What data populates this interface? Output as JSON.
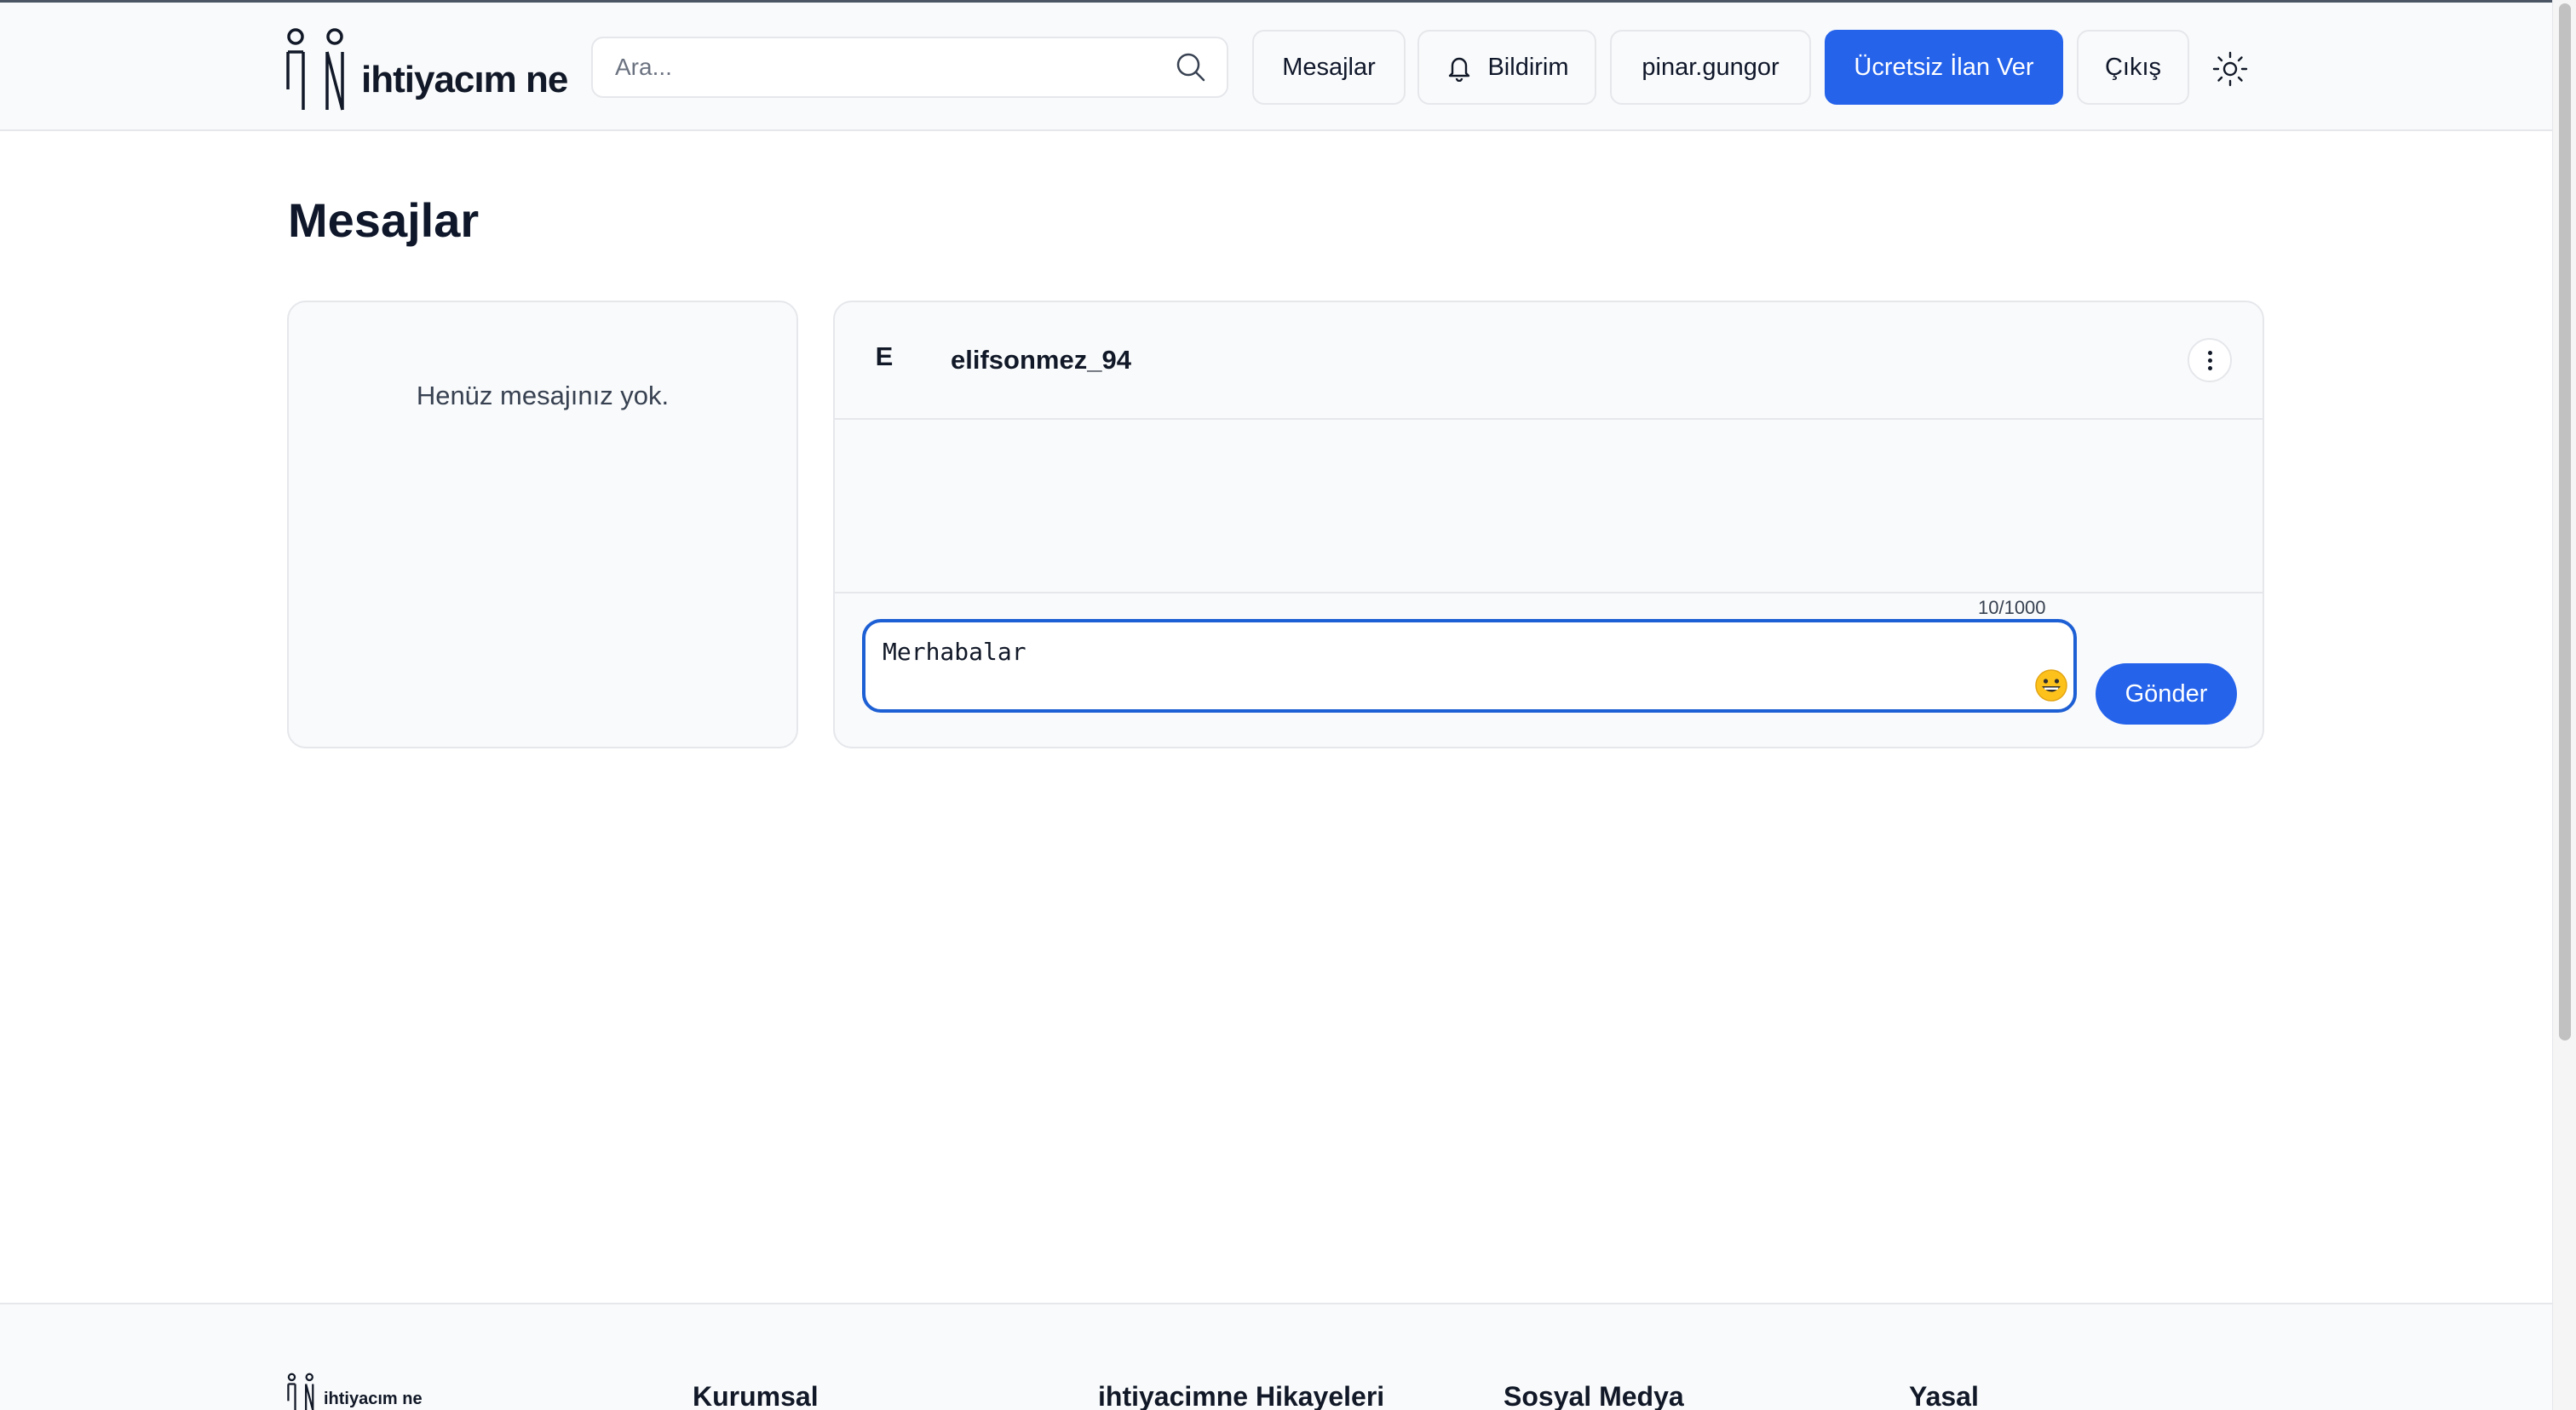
{
  "header": {
    "logo_text": "ihtiyacım ne",
    "search_placeholder": "Ara...",
    "nav": {
      "messages": "Mesajlar",
      "notifications": "Bildirim",
      "username": "pinar.gungor",
      "post_ad": "Ücretsiz İlan Ver",
      "logout": "Çıkış"
    }
  },
  "page": {
    "title": "Mesajlar"
  },
  "conversations": {
    "empty_text": "Henüz mesajınız yok."
  },
  "chat": {
    "avatar_initial": "E",
    "username": "elifsonmez_94",
    "char_counter": "10/1000",
    "message_value": "Merhabalar",
    "send_label": "Gönder"
  },
  "footer": {
    "logo_text": "ihtiyacım ne",
    "columns": [
      "Kurumsal",
      "ihtiyacimne Hikayeleri",
      "Sosyal Medya",
      "Yasal"
    ]
  },
  "colors": {
    "primary": "#2563eb",
    "focus_border": "#1d5fd4",
    "background_alt": "#f9fafb",
    "border": "#e5e7eb"
  },
  "icons": [
    "search-icon",
    "bell-icon",
    "sun-icon",
    "more-vertical-icon",
    "emoji-icon"
  ]
}
